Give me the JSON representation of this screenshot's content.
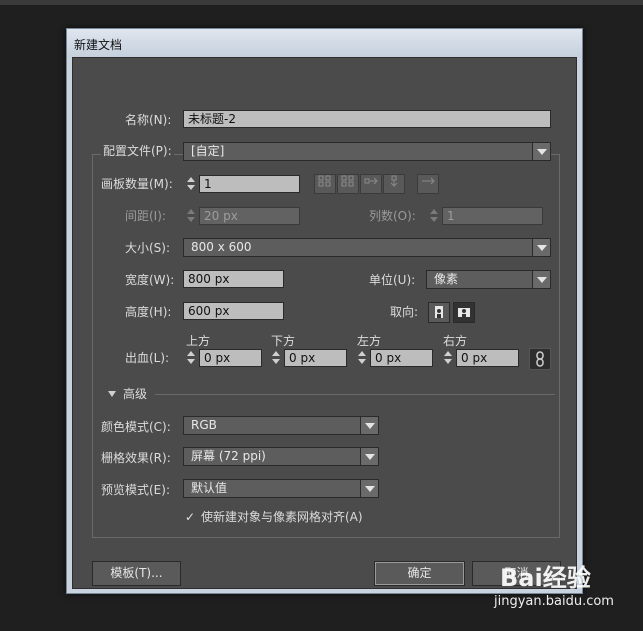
{
  "dialog": {
    "title": "新建文档",
    "name": {
      "label": "名称(N):",
      "value": "未标题-2"
    },
    "profile": {
      "label": "配置文件(P):",
      "value": "[自定]"
    },
    "artboards": {
      "label": "画板数量(M):",
      "value": "1",
      "icons": [
        "grid-by-row-icon",
        "grid-by-column-icon",
        "arrange-by-row-icon",
        "arrange-by-column-icon",
        "right-to-left-icon"
      ]
    },
    "spacing": {
      "label": "间距(I):",
      "value": "20 px"
    },
    "columns": {
      "label": "列数(O):",
      "value": "1"
    },
    "size": {
      "label": "大小(S):",
      "value": "800 x 600"
    },
    "width": {
      "label": "宽度(W):",
      "value": "800 px"
    },
    "units": {
      "label": "单位(U):",
      "value": "像素"
    },
    "height": {
      "label": "高度(H):",
      "value": "600 px"
    },
    "orientation": {
      "label": "取向:",
      "options": [
        "portrait-icon",
        "landscape-icon"
      ]
    },
    "bleed": {
      "label": "出血(L):",
      "top": {
        "label": "上方",
        "value": "0 px"
      },
      "bottom": {
        "label": "下方",
        "value": "0 px"
      },
      "left": {
        "label": "左方",
        "value": "0 px"
      },
      "right": {
        "label": "右方",
        "value": "0 px"
      },
      "link_icon": "chain-link-icon"
    },
    "advanced": {
      "label": "高级",
      "color_mode": {
        "label": "颜色模式(C):",
        "value": "RGB"
      },
      "raster": {
        "label": "栅格效果(R):",
        "value": "屏幕 (72 ppi)"
      },
      "preview": {
        "label": "预览模式(E):",
        "value": "默认值"
      },
      "align_checkbox": {
        "label": "使新建对象与像素网格对齐(A)",
        "checked": true
      }
    },
    "buttons": {
      "templates": "模板(T)...",
      "ok": "确定",
      "cancel": "取消"
    }
  },
  "watermark": {
    "brand": "Bai经验",
    "url": "jingyan.baidu.com"
  }
}
